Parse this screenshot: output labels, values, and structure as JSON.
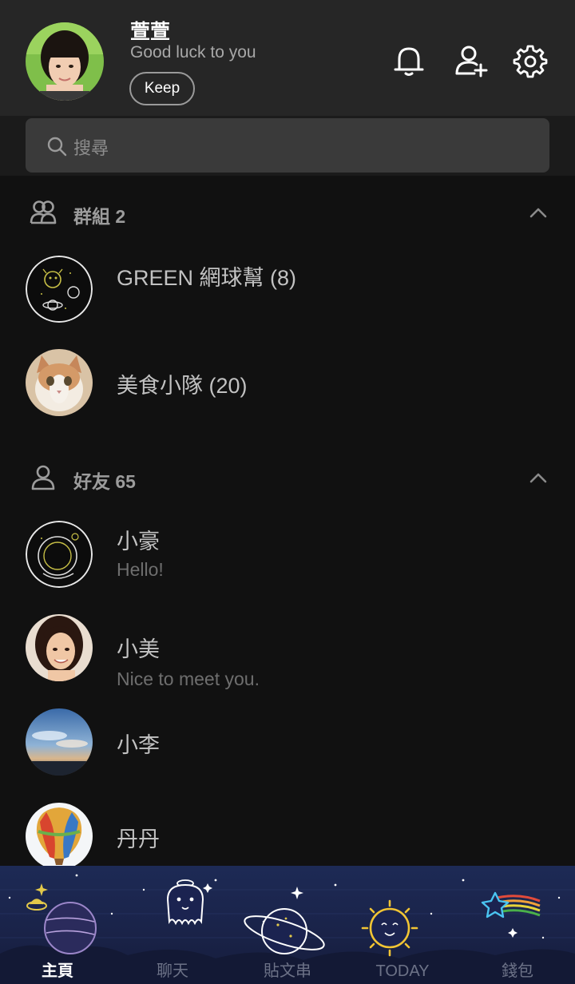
{
  "profile": {
    "name": "萱萱",
    "status": "Good luck to you",
    "keep_label": "Keep"
  },
  "search": {
    "placeholder": "搜尋"
  },
  "groups": {
    "title": "群組 2",
    "items": [
      {
        "name": "GREEN 網球幫 (8)",
        "avatar": "space-doodle"
      },
      {
        "name": "美食小隊 (20)",
        "avatar": "cat-photo"
      }
    ]
  },
  "friends": {
    "title": "好友 65",
    "items": [
      {
        "name": "小豪",
        "status": "Hello!",
        "avatar": "astronaut-doodle"
      },
      {
        "name": "小美",
        "status": "Nice to meet you.",
        "avatar": "woman-photo"
      },
      {
        "name": "小李",
        "status": "",
        "avatar": "sky-photo"
      },
      {
        "name": "丹丹",
        "status": "",
        "avatar": "balloon-photo"
      }
    ]
  },
  "nav": {
    "items": [
      {
        "label": "主頁",
        "icon": "planet-icon",
        "active": true
      },
      {
        "label": "聊天",
        "icon": "ghost-icon",
        "active": false
      },
      {
        "label": "貼文串",
        "icon": "saturn-icon",
        "active": false
      },
      {
        "label": "TODAY",
        "icon": "sun-icon",
        "active": false
      },
      {
        "label": "錢包",
        "icon": "shooting-star-icon",
        "active": false
      }
    ]
  },
  "colors": {
    "background": "#111111",
    "header": "#262626",
    "search_box": "#3a3a3a",
    "nav_background": "#1d2a55"
  }
}
